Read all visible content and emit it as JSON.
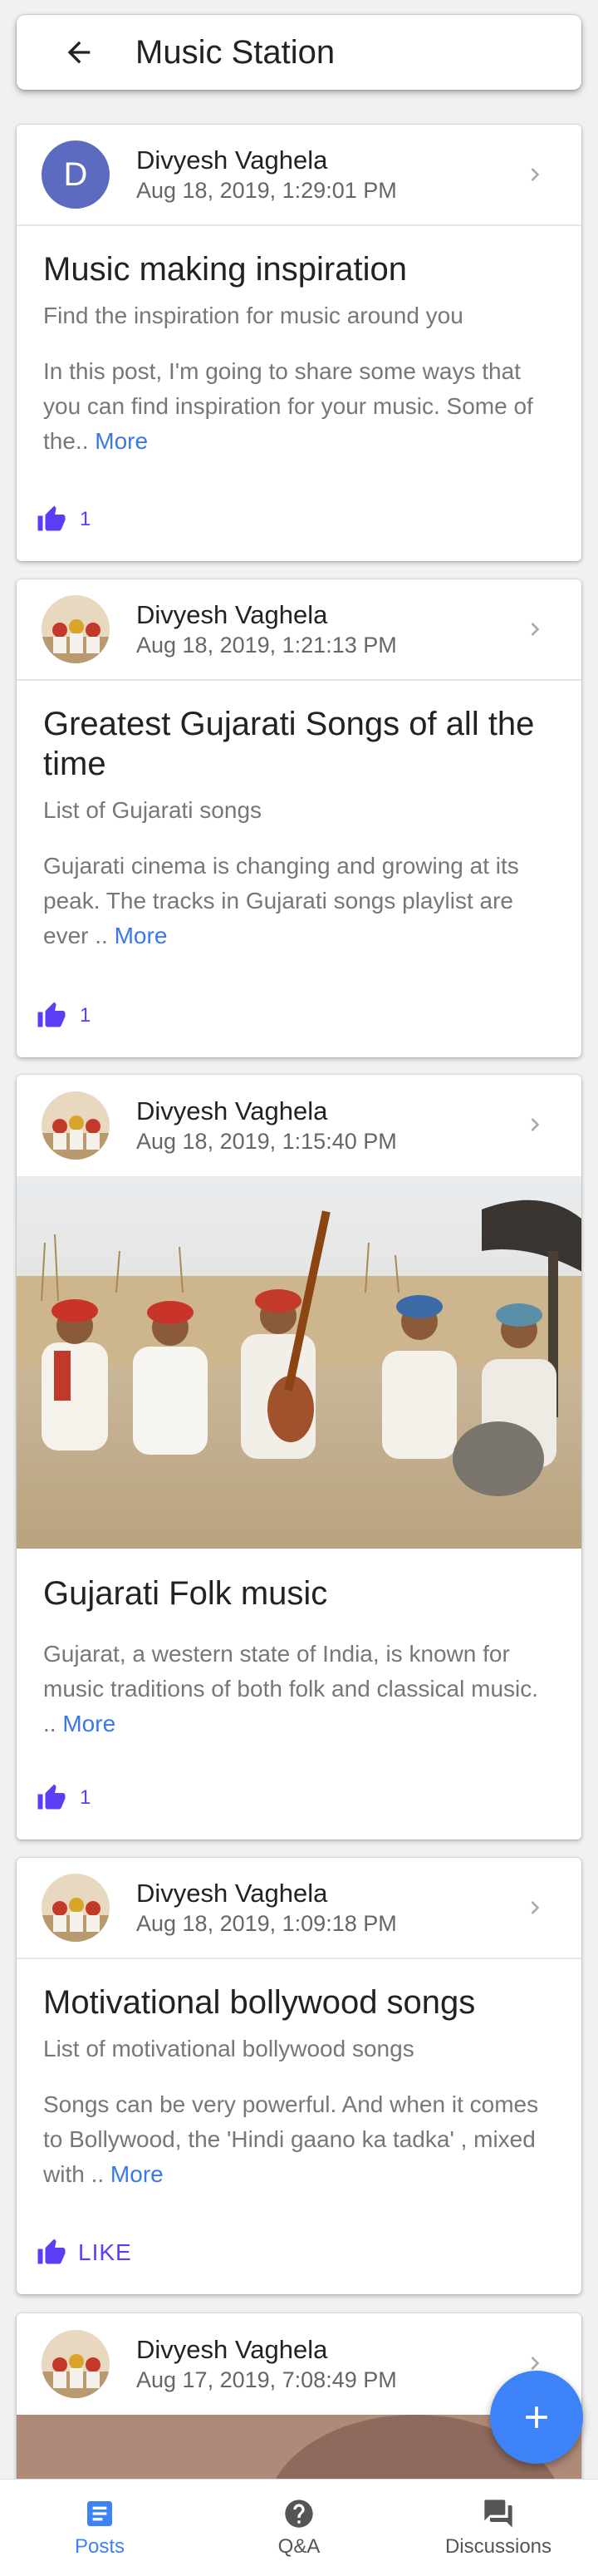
{
  "appbar": {
    "title": "Music Station"
  },
  "posts": [
    {
      "author": "Divyesh Vaghela",
      "date": "Aug 18, 2019, 1:29:01 PM",
      "avatar_letter": "D",
      "title": "Music making inspiration",
      "subtitle": "Find the inspiration for music around you",
      "excerpt": "In this post, I'm going to share some ways that you can find inspiration for your music. Some of the.. ",
      "more": "More",
      "likes": "1"
    },
    {
      "author": "Divyesh Vaghela",
      "date": "Aug 18, 2019, 1:21:13 PM",
      "title": "Greatest Gujarati Songs of all the time",
      "subtitle": "List of Gujarati songs",
      "excerpt": "Gujarati cinema is changing and growing at its peak. The tracks in Gujarati songs playlist are ever .. ",
      "more": "More",
      "likes": "1"
    },
    {
      "author": "Divyesh Vaghela",
      "date": "Aug 18, 2019, 1:15:40 PM",
      "title": "Gujarati Folk music",
      "excerpt": "Gujarat, a western state of India, is known for music traditions of both folk and classical music. .. ",
      "more": "More",
      "likes": "1"
    },
    {
      "author": "Divyesh Vaghela",
      "date": "Aug 18, 2019, 1:09:18 PM",
      "title": "Motivational bollywood songs",
      "subtitle": "List of motivational bollywood songs",
      "excerpt": "Songs can be very powerful. And when it comes to Bollywood, the 'Hindi gaano ka tadka' , mixed with .. ",
      "more": "More",
      "like_label": "LIKE"
    },
    {
      "author": "Divyesh Vaghela",
      "date": "Aug 17, 2019, 7:08:49 PM"
    }
  ],
  "nav": {
    "posts": "Posts",
    "qa": "Q&A",
    "discussions": "Discussions"
  },
  "colors": {
    "accent": "#3d82f7",
    "like": "#5b3df5",
    "nav_active": "#3d82f7",
    "nav_inactive": "#555555"
  },
  "icons": {
    "back": "arrow-back-icon",
    "chevron": "chevron-right-icon",
    "like": "thumb-up-icon",
    "fab": "plus-icon",
    "posts": "article-icon",
    "qa": "help-circle-icon",
    "discussions": "forum-icon"
  }
}
